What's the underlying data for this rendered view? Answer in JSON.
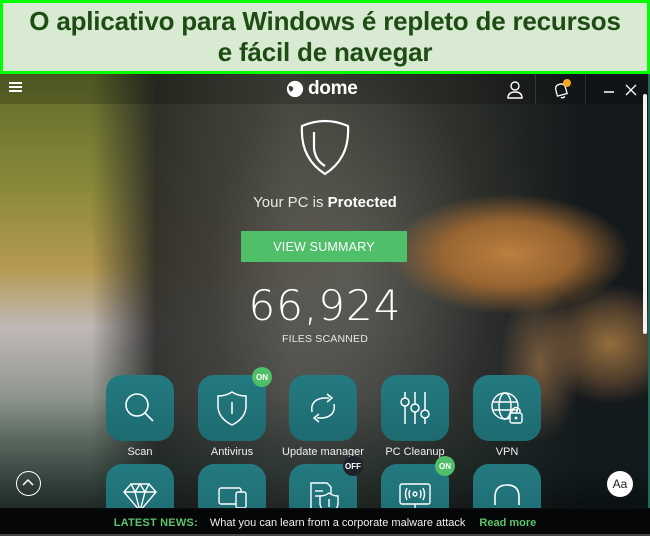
{
  "caption": {
    "text": "O aplicativo para Windows é repleto de recursos e fácil de navegar",
    "border_color": "#00ff00",
    "background_color": "#d9ead3",
    "text_color": "#1e4d13"
  },
  "titlebar": {
    "menu_icon": "hamburger-menu-icon",
    "logo_text": "dome",
    "account_icon": "user-icon",
    "notifications_icon": "bell-icon",
    "notification_indicator_color": "#f5a623",
    "minimize_icon": "minimize-icon",
    "close_icon": "close-icon"
  },
  "hero": {
    "shield_icon": "shield-icon",
    "status_prefix": "Your PC is ",
    "status_value": "Protected",
    "view_summary_label": "VIEW SUMMARY",
    "files_scanned_count": "66,924",
    "files_scanned_label": "FILES SCANNED"
  },
  "tiles": [
    {
      "label": "Scan",
      "icon": "search-icon",
      "badge": null
    },
    {
      "label": "Antivirus",
      "icon": "shield-icon",
      "badge": "ON"
    },
    {
      "label": "Update manager",
      "icon": "refresh-arrows-icon",
      "badge": null
    },
    {
      "label": "PC Cleanup",
      "icon": "sliders-icon",
      "badge": null
    },
    {
      "label": "VPN",
      "icon": "globe-lock-icon",
      "badge": null
    },
    {
      "label": "",
      "icon": "diamond-icon",
      "badge": null
    },
    {
      "label": "",
      "icon": "devices-icon",
      "badge": null
    },
    {
      "label": "",
      "icon": "document-shield-icon",
      "badge": "OFF"
    },
    {
      "label": "",
      "icon": "monitor-signal-icon",
      "badge": "ON"
    },
    {
      "label": "",
      "icon": "headset-icon",
      "badge": null
    }
  ],
  "controls": {
    "scroll_up_icon": "chevron-up-circle-icon",
    "font_size_label": "Aa"
  },
  "news": {
    "label": "LATEST NEWS:",
    "headline": "What you can learn from a corporate malware attack",
    "link": "Read more"
  },
  "colors": {
    "accent_green": "#4fbf6a",
    "tile_teal": "#1f7178",
    "badge_off": "#1f2228"
  }
}
